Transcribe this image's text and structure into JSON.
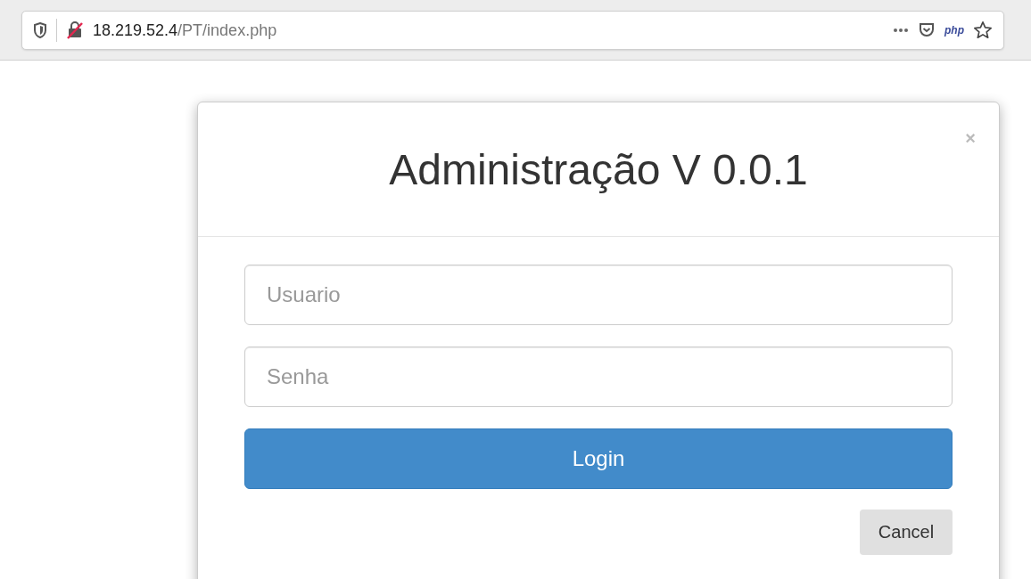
{
  "browser": {
    "url_host": "18.219.52.4",
    "url_path": "/PT/index.php",
    "extension_label": "php"
  },
  "modal": {
    "close": "×",
    "title": "Administração V 0.0.1",
    "fields": [
      {
        "placeholder": "Usuario"
      },
      {
        "placeholder": "Senha"
      }
    ],
    "login_button": "Login",
    "cancel_button": "Cancel"
  }
}
